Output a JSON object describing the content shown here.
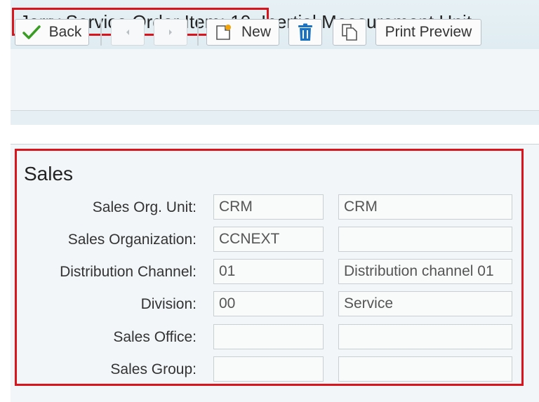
{
  "header": {
    "title_part1": "Jerry Service Order Item: 10,",
    "title_part2": "Inertial Measurement Unit"
  },
  "toolbar": {
    "back_label": "Back",
    "new_label": "New",
    "print_preview_label": "Print Preview"
  },
  "sales": {
    "section_title": "Sales",
    "rows": [
      {
        "label": "Sales Org. Unit:",
        "value1": "CRM",
        "value2": "CRM"
      },
      {
        "label": "Sales Organization:",
        "value1": "CCNEXT",
        "value2": ""
      },
      {
        "label": "Distribution Channel:",
        "value1": "01",
        "value2": "Distribution channel 01"
      },
      {
        "label": "Division:",
        "value1": "00",
        "value2": "Service"
      },
      {
        "label": "Sales Office:",
        "value1": "",
        "value2": ""
      },
      {
        "label": "Sales Group:",
        "value1": "",
        "value2": ""
      }
    ]
  },
  "colors": {
    "highlight_border": "#d9141c",
    "check_green": "#3a9d23",
    "trash_blue": "#1a73c2",
    "new_star_orange": "#f0a30a"
  }
}
